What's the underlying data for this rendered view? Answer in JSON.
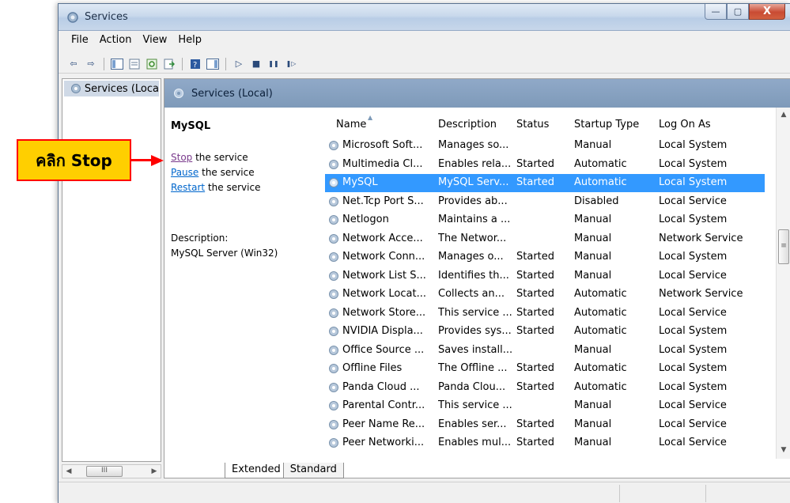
{
  "window": {
    "title": "Services",
    "buttons": {
      "minimize": "—",
      "maximize": "▢",
      "close": "X"
    }
  },
  "menu": [
    "File",
    "Action",
    "View",
    "Help"
  ],
  "toolbar": {
    "back": "⇦",
    "forward": "⇨",
    "play": "▷",
    "stop": "■",
    "pause": "❚❚",
    "resume": "❚▷"
  },
  "tree": {
    "item": "Services (Loca"
  },
  "pane": {
    "title": "Services (Local)",
    "selected_service": "MySQL",
    "actions": [
      {
        "link": "Stop",
        "rest": " the service"
      },
      {
        "link": "Pause",
        "rest": " the service"
      },
      {
        "link": "Restart",
        "rest": " the service"
      }
    ],
    "description_label": "Description:",
    "description_text": "MySQL Server (Win32)"
  },
  "columns": [
    "Name",
    "Description",
    "Status",
    "Startup Type",
    "Log On As"
  ],
  "rows": [
    {
      "name": "Microsoft Soft...",
      "description": "Manages so...",
      "status": "",
      "startup": "Manual",
      "logon": "Local System"
    },
    {
      "name": "Multimedia Cl...",
      "description": "Enables rela...",
      "status": "Started",
      "startup": "Automatic",
      "logon": "Local System"
    },
    {
      "name": "MySQL",
      "description": "MySQL Serv...",
      "status": "Started",
      "startup": "Automatic",
      "logon": "Local System",
      "selected": true
    },
    {
      "name": "Net.Tcp Port S...",
      "description": "Provides ab...",
      "status": "",
      "startup": "Disabled",
      "logon": "Local Service"
    },
    {
      "name": "Netlogon",
      "description": "Maintains a ...",
      "status": "",
      "startup": "Manual",
      "logon": "Local System"
    },
    {
      "name": "Network Acce...",
      "description": "The Networ...",
      "status": "",
      "startup": "Manual",
      "logon": "Network Service"
    },
    {
      "name": "Network Conn...",
      "description": "Manages o...",
      "status": "Started",
      "startup": "Manual",
      "logon": "Local System"
    },
    {
      "name": "Network List S...",
      "description": "Identifies th...",
      "status": "Started",
      "startup": "Manual",
      "logon": "Local Service"
    },
    {
      "name": "Network Locat...",
      "description": "Collects an...",
      "status": "Started",
      "startup": "Automatic",
      "logon": "Network Service"
    },
    {
      "name": "Network Store...",
      "description": "This service ...",
      "status": "Started",
      "startup": "Automatic",
      "logon": "Local Service"
    },
    {
      "name": "NVIDIA Displa...",
      "description": "Provides sys...",
      "status": "Started",
      "startup": "Automatic",
      "logon": "Local System"
    },
    {
      "name": "Office Source ...",
      "description": "Saves install...",
      "status": "",
      "startup": "Manual",
      "logon": "Local System"
    },
    {
      "name": "Offline Files",
      "description": "The Offline ...",
      "status": "Started",
      "startup": "Automatic",
      "logon": "Local System"
    },
    {
      "name": "Panda Cloud ...",
      "description": "Panda Clou...",
      "status": "Started",
      "startup": "Automatic",
      "logon": "Local System"
    },
    {
      "name": "Parental Contr...",
      "description": "This service ...",
      "status": "",
      "startup": "Manual",
      "logon": "Local Service"
    },
    {
      "name": "Peer Name Re...",
      "description": "Enables ser...",
      "status": "Started",
      "startup": "Manual",
      "logon": "Local Service"
    },
    {
      "name": "Peer Networki...",
      "description": "Enables mul...",
      "status": "Started",
      "startup": "Manual",
      "logon": "Local Service"
    }
  ],
  "tabs": [
    "Extended",
    "Standard"
  ],
  "scrollbar": {
    "grip": "III",
    "left": "◀",
    "right": "▶",
    "up": "▲",
    "down": "▼"
  },
  "callout": {
    "text": "คลิก Stop"
  },
  "colors": {
    "selection": "#3399ff",
    "callout_fill": "#ffcf00",
    "callout_border": "#ff0000",
    "header": "#7e9ab9"
  }
}
